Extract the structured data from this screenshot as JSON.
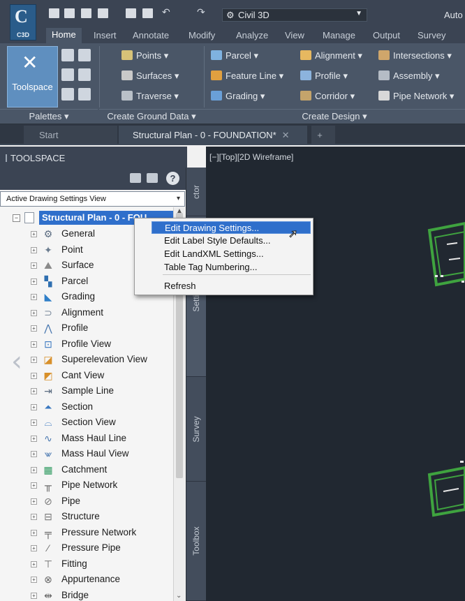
{
  "app": {
    "logo_text": "C",
    "logo_caption": "C3D",
    "workspace": "Civil 3D",
    "title_fragment": "Auto"
  },
  "ribbon_tabs": [
    "Home",
    "Insert",
    "Annotate",
    "Modify",
    "Analyze",
    "View",
    "Manage",
    "Output",
    "Survey"
  ],
  "ribbon": {
    "toolspace_label": "Toolspace",
    "palettes_label": "Palettes",
    "ground_data": {
      "items": [
        "Points",
        "Surfaces",
        "Traverse"
      ],
      "footer": "Create Ground Data"
    },
    "design": {
      "col1": [
        "Parcel",
        "Feature Line",
        "Grading"
      ],
      "col2": [
        "Alignment",
        "Profile",
        "Corridor"
      ],
      "col3": [
        "Intersections",
        "Assembly",
        "Pipe Network"
      ],
      "footer": "Create Design"
    }
  },
  "doc_tabs": {
    "start": "Start",
    "active": "Structural Plan - 0 - FOUNDATION*",
    "close": "✕",
    "add": "+"
  },
  "toolspace": {
    "title": "TOOLSPACE",
    "help": "?",
    "view_select": "Active Drawing Settings View",
    "root": "Structural Plan - 0 - FOU",
    "items": [
      "General",
      "Point",
      "Surface",
      "Parcel",
      "Grading",
      "Alignment",
      "Profile",
      "Profile View",
      "Superelevation View",
      "Cant View",
      "Sample Line",
      "Section",
      "Section View",
      "Mass Haul Line",
      "Mass Haul View",
      "Catchment",
      "Pipe Network",
      "Pipe",
      "Structure",
      "Pressure Network",
      "Pressure Pipe",
      "Fitting",
      "Appurtenance",
      "Bridge"
    ],
    "icons": [
      "gear-icon",
      "point-icon",
      "surface-icon",
      "parcel-icon",
      "grading-icon",
      "alignment-icon",
      "profile-icon",
      "profile-view-icon",
      "superelevation-icon",
      "cant-view-icon",
      "sample-line-icon",
      "section-icon",
      "section-view-icon",
      "mass-haul-line-icon",
      "mass-haul-view-icon",
      "catchment-icon",
      "pipe-network-icon",
      "pipe-icon",
      "structure-icon",
      "pressure-network-icon",
      "pressure-pipe-icon",
      "fitting-icon",
      "appurtenance-icon",
      "bridge-icon"
    ]
  },
  "side_tabs": [
    "ctor",
    "Settings",
    "Survey",
    "Toolbox"
  ],
  "viewport": {
    "label": "[−][Top][2D Wireframe]"
  },
  "context_menu": {
    "items": [
      "Edit Drawing Settings...",
      "Edit Label Style Defaults...",
      "Edit LandXML Settings...",
      "Table Tag Numbering...",
      "Refresh"
    ],
    "highlighted": 0
  },
  "colors": {
    "accent": "#2f6fcb",
    "drawing_bg": "#212831",
    "object_green": "#3fa33f"
  }
}
